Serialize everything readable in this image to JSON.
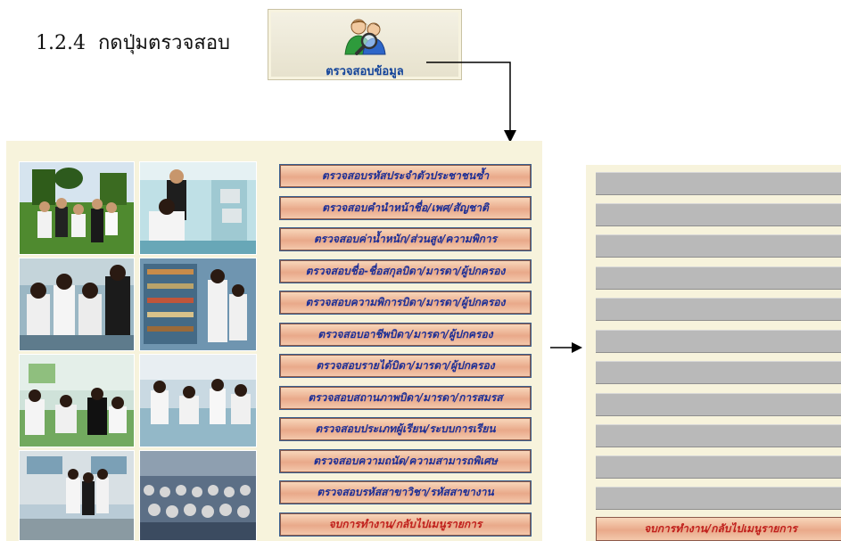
{
  "step": {
    "number": "1.2.4",
    "text": "กดปุ่มตรวจสอบ"
  },
  "check_button": {
    "label": "ตรวจสอบข้อมูล",
    "icon": "people-magnifier-icon"
  },
  "menu": {
    "items": [
      "ตรวจสอบรหัสประจำตัวประชาชนซ้ำ",
      "ตรวจสอบคำนำหน้าชื่อ/เพศ/สัญชาติ",
      "ตรวจสอบค่าน้ำหนัก/ส่วนสูง/ความพิการ",
      "ตรวจสอบชื่อ-ชื่อสกุลบิดา/มารดา/ผู้ปกครอง",
      "ตรวจสอบความพิการบิดา/มารดา/ผู้ปกครอง",
      "ตรวจสอบอาชีพบิดา/มารดา/ผู้ปกครอง",
      "ตรวจสอบรายได้บิดา/มารดา/ผู้ปกครอง",
      "ตรวจสอบสถานภาพบิดา/มารดา/การสมรส",
      "ตรวจสอบประเภทผู้เรียน/ระบบการเรียน",
      "ตรวจสอบความถนัด/ความสามารถพิเศษ",
      "ตรวจสอบรหัสสาขาวิชา/รหัสสาขางาน"
    ],
    "exit_label": "จบการทำงาน/กลับไปเมนูรายการ"
  },
  "result_panel": {
    "exit_label": "จบการทำงาน/กลับไปเมนูรายการ"
  },
  "colors": {
    "menu_text": "#1d2f96",
    "exit_text": "#c0201c",
    "panel_bg": "#f7f3dc",
    "button_face": "#e9a98a"
  }
}
